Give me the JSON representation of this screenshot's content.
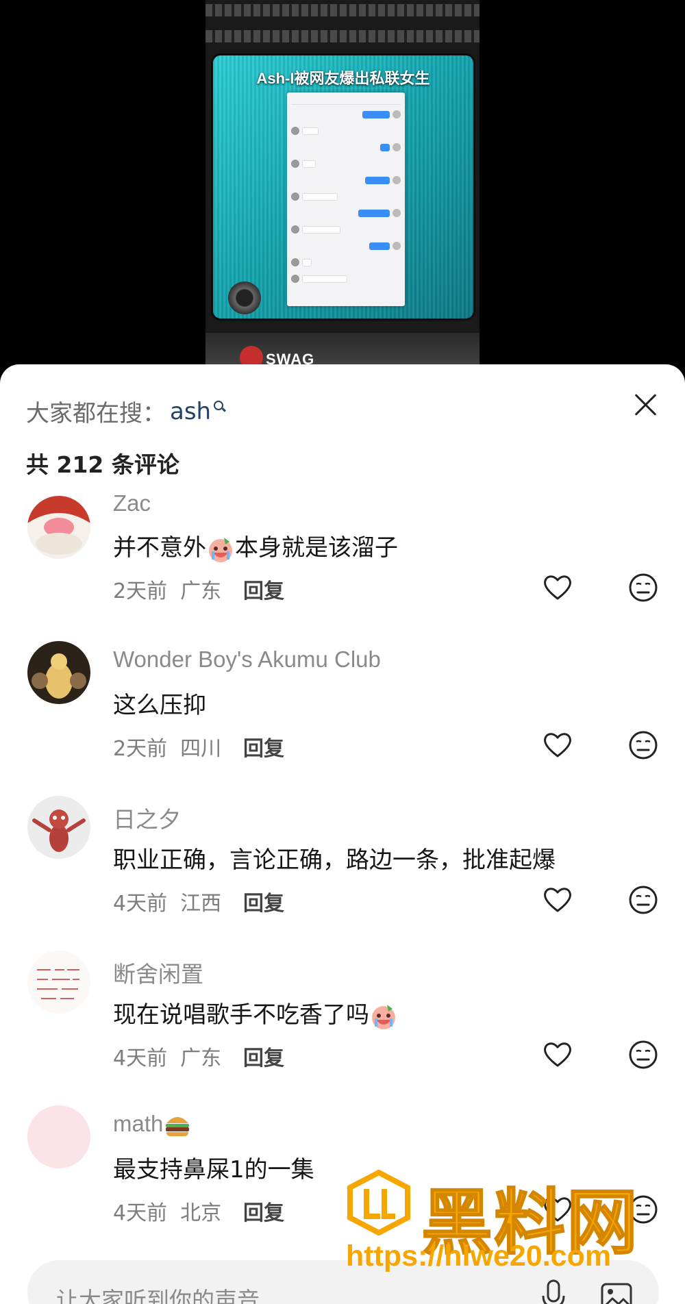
{
  "video": {
    "title": "Ash-I被网友爆出私联女生",
    "logo_text": "SWAG"
  },
  "sheet": {
    "search_prefix": "大家都在搜：",
    "search_term": "ash",
    "comment_count": "共 212 条评论",
    "input_placeholder": "让大家听到你的声音"
  },
  "comments": [
    {
      "user": "Zac",
      "text_before": "并不意外",
      "emoji": "crying-face-emoji",
      "text_after": "本身就是该溜子",
      "time": "2天前",
      "region": "广东",
      "reply": "回复"
    },
    {
      "user": "Wonder Boy's Akumu Club",
      "text": "这么压抑",
      "time": "2天前",
      "region": "四川",
      "reply": "回复"
    },
    {
      "user": "日之夕",
      "text": "职业正确，言论正确，路边一条，批准起爆",
      "time": "4天前",
      "region": "江西",
      "reply": "回复"
    },
    {
      "user": "断舍闲置",
      "text": "现在说唱歌手不吃香了吗",
      "emoji": "crying-face-emoji",
      "time": "4天前",
      "region": "广东",
      "reply": "回复"
    },
    {
      "user": "math",
      "user_emoji": "hamburger-emoji",
      "text": "最支持鼻屎1的一集",
      "time": "4天前",
      "region": "北京",
      "reply": "回复"
    }
  ],
  "watermark": {
    "brand": "黑料网",
    "url": "https://hlwe20.com"
  },
  "colors": {
    "accent_link": "#24416a",
    "watermark": "#f7a600",
    "video_teal": "#17a9b3"
  }
}
